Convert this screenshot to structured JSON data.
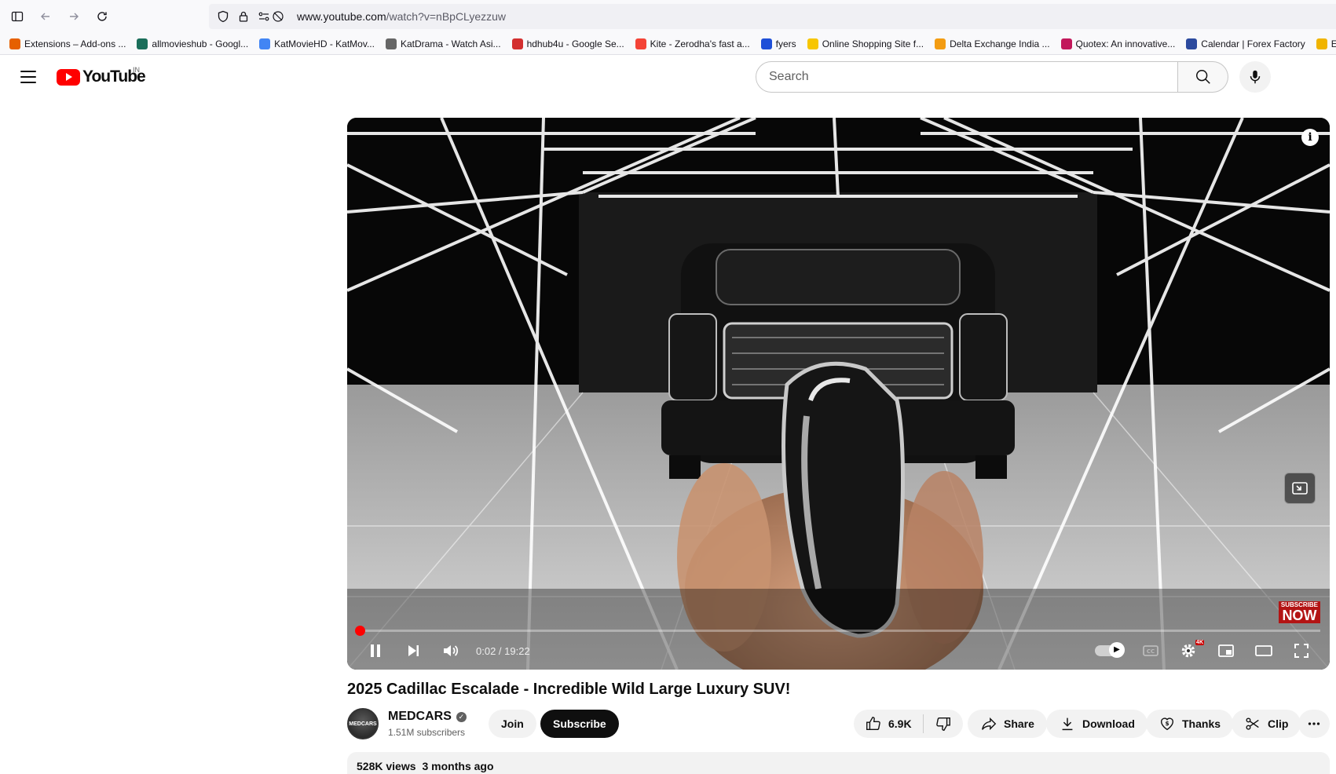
{
  "browser": {
    "url_host": "www.youtube.com",
    "url_path": "/watch?v=nBpCLyezzuw",
    "bookmarks": [
      {
        "label": "Extensions – Add-ons ...",
        "color": "#e66000"
      },
      {
        "label": "allmovieshub - Googl...",
        "color": "#1a6e5a"
      },
      {
        "label": "KatMovieHD - KatMov...",
        "color": "#4285f4"
      },
      {
        "label": "KatDrama - Watch Asi...",
        "color": "#666666"
      },
      {
        "label": "hdhub4u - Google Se...",
        "color": "#d32f2f"
      },
      {
        "label": "Kite - Zerodha's fast a...",
        "color": "#f44336"
      },
      {
        "label": "fyers",
        "color": "#1e4fd8"
      },
      {
        "label": "Online Shopping Site f...",
        "color": "#f7c600"
      },
      {
        "label": "Delta Exchange India ...",
        "color": "#f39c12"
      },
      {
        "label": "Quotex: An innovative...",
        "color": "#c2185b"
      },
      {
        "label": "Calendar | Forex Factory",
        "color": "#2c4a9e"
      },
      {
        "label": "Ex",
        "color": "#f0b400"
      }
    ]
  },
  "youtube": {
    "logo_text": "YouTube",
    "country_code": "IN",
    "search_placeholder": "Search"
  },
  "player": {
    "current_time": "0:02",
    "duration": "19:22",
    "progress_fraction": 0.0017,
    "subscribe_overlay_top": "SUBSCRIBE",
    "subscribe_overlay_bottom": "NOW",
    "quality_badge": "4K"
  },
  "video": {
    "title": "2025 Cadillac Escalade - Incredible Wild Large Luxury SUV!",
    "channel_name": "MEDCARS",
    "avatar_text": "MEDCARS",
    "subscribers": "1.51M subscribers",
    "join_label": "Join",
    "subscribe_label": "Subscribe",
    "likes": "6.9K",
    "share_label": "Share",
    "download_label": "Download",
    "thanks_label": "Thanks",
    "clip_label": "Clip",
    "views": "528K views",
    "age": "3 months ago"
  }
}
